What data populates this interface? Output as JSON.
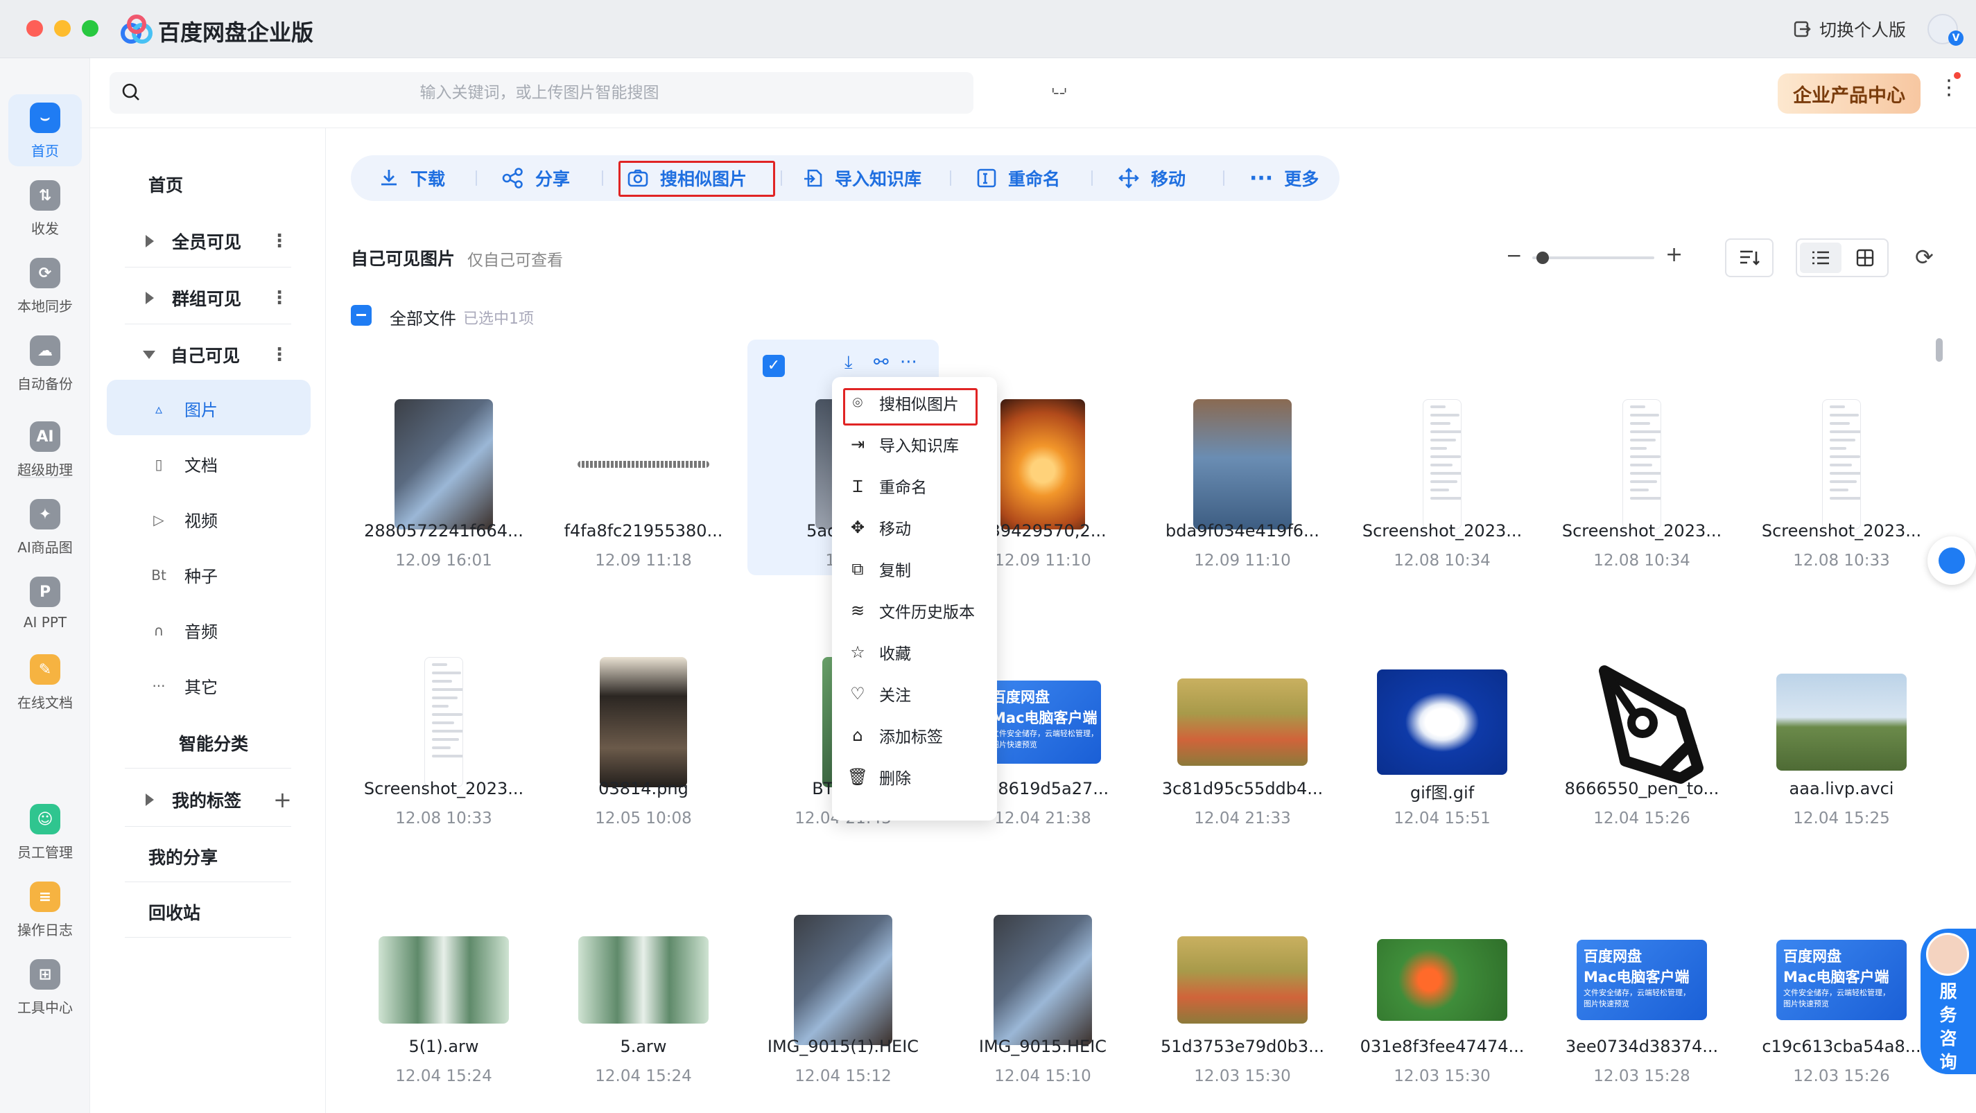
{
  "app": {
    "title": "百度网盘企业版",
    "switch_personal": "切换个人版",
    "avatar_badge": "V"
  },
  "rail": [
    {
      "label": "首页",
      "icon": "home-icon",
      "glyph": "⌣",
      "active": true
    },
    {
      "label": "收发",
      "icon": "transfer-icon",
      "glyph": "⇅"
    },
    {
      "label": "本地同步",
      "icon": "sync-icon",
      "glyph": "⟳"
    },
    {
      "label": "自动备份",
      "icon": "backup-icon",
      "glyph": "☁"
    },
    {
      "label": "超级助理",
      "icon": "ai-assistant-icon",
      "glyph": "AI"
    },
    {
      "label": "AI商品图",
      "icon": "ai-product-icon",
      "glyph": "✦"
    },
    {
      "label": "AI PPT",
      "icon": "ai-ppt-icon",
      "glyph": "P"
    },
    {
      "label": "在线文档",
      "icon": "online-doc-icon",
      "glyph": "✎"
    },
    {
      "label": "员工管理",
      "icon": "staff-icon",
      "glyph": "☺"
    },
    {
      "label": "操作日志",
      "icon": "log-icon",
      "glyph": "≡"
    },
    {
      "label": "工具中心",
      "icon": "tools-icon",
      "glyph": "⊞"
    }
  ],
  "search": {
    "placeholder": "输入关键词，或上传图片智能搜图"
  },
  "enterprise_btn": "企业产品中心",
  "sidebar": {
    "home": "首页",
    "all_visible": "全员可见",
    "group_visible": "群组可见",
    "self_visible": "自己可见",
    "subs": [
      "图片",
      "文档",
      "视频",
      "种子",
      "音频",
      "其它"
    ],
    "sub_icons": [
      "▵",
      "▯",
      "▷",
      "Bt",
      "∩",
      "···"
    ],
    "smart": "智能分类",
    "my_tags": "我的标签",
    "my_share": "我的分享",
    "recycle": "回收站"
  },
  "toolbar": {
    "download": "下载",
    "share": "分享",
    "similar": "搜相似图片",
    "import_kb": "导入知识库",
    "rename": "重命名",
    "move": "移动",
    "more": "更多"
  },
  "section": {
    "title": "自己可见图片",
    "subtitle": "仅自己可查看"
  },
  "list": {
    "all_files": "全部文件",
    "selected": "已选中1项"
  },
  "context_menu": [
    "搜相似图片",
    "导入知识库",
    "重命名",
    "移动",
    "复制",
    "文件历史版本",
    "收藏",
    "关注",
    "添加标签",
    "删除"
  ],
  "files": [
    {
      "name": "2880572241f664...",
      "date": "12.09 16:01"
    },
    {
      "name": "f4fa8fc21955380...",
      "date": "12.09 11:18"
    },
    {
      "name": "5ad06ab",
      "date": "12.0"
    },
    {
      "name": "739429570,2...",
      "date": "12.09 11:10"
    },
    {
      "name": "bda9f034e419f6...",
      "date": "12.09 11:10"
    },
    {
      "name": "Screenshot_2023...",
      "date": "12.08 10:34"
    },
    {
      "name": "Screenshot_2023...",
      "date": "12.08 10:34"
    },
    {
      "name": "Screenshot_2023...",
      "date": "12.08 10:33"
    },
    {
      "name": "Screenshot_2023...",
      "date": "12.08 10:33"
    },
    {
      "name": "03814.png",
      "date": "12.05 10:08"
    },
    {
      "name": "BT1_K0",
      "date": "12.04 21:43"
    },
    {
      "name": "938619d5a27...",
      "date": "12.04 21:38"
    },
    {
      "name": "3c81d95c55ddb4...",
      "date": "12.04 21:33"
    },
    {
      "name": "gif图.gif",
      "date": "12.04 15:51"
    },
    {
      "name": "8666550_pen_to...",
      "date": "12.04 15:26"
    },
    {
      "name": "aaa.livp.avci",
      "date": "12.04 15:25"
    },
    {
      "name": "5(1).arw",
      "date": "12.04 15:24"
    },
    {
      "name": "5.arw",
      "date": "12.04 15:24"
    },
    {
      "name": "IMG_9015(1).HEIC",
      "date": "12.04 15:12"
    },
    {
      "name": "IMG_9015.HEIC",
      "date": "12.04 15:10"
    },
    {
      "name": "51d3753e79d0b3...",
      "date": "12.03 15:30"
    },
    {
      "name": "031e8f3fee47474...",
      "date": "12.03 15:30"
    },
    {
      "name": "3ee0734d38374...",
      "date": "12.03 15:28"
    },
    {
      "name": "c19c613cba54a8...",
      "date": "12.03 15:26"
    }
  ],
  "banner": {
    "line1": "百度网盘",
    "line2": "Mac电脑客户端",
    "line3": "文件安全储存，云端轻松管理，",
    "line4": "图片快速预览"
  },
  "service": "服务咨询",
  "colors": {
    "accent": "#1f7cf3",
    "highlight_box": "#e02424"
  }
}
